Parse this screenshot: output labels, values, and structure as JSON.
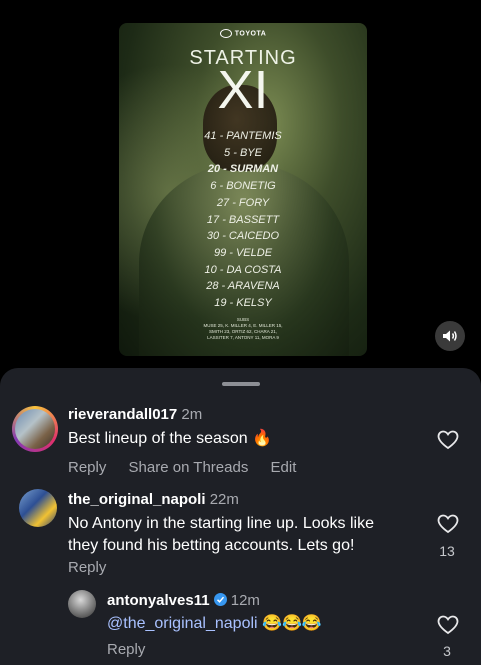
{
  "poster": {
    "brand": "TOYOTA",
    "title_small": "STARTING",
    "title_big": "XI",
    "lineup": [
      "41 - PANTEMIS",
      "5 - BYE",
      "20 - SURMAN",
      "6 - BONETIG",
      "27 - FORY",
      "17 - BASSETT",
      "30 - CAICEDO",
      "99 - VELDE",
      "10 - DA COSTA",
      "28 - ARAVENA",
      "19 - KELSY"
    ],
    "subs_label": "SUBS",
    "subs_line1": "MUSE 25, K. MILLER 4, E. MILLER 15,",
    "subs_line2": "SMITH 23, ORTIZ 62, CHARA 21,",
    "subs_line3": "LASSITER 7, ANTONY 11, MORA 9"
  },
  "sound_icon": "speaker-icon",
  "comments": [
    {
      "username": "rieverandall017",
      "time": "2m",
      "text": "Best lineup of the season 🔥",
      "reply": "Reply",
      "share": "Share on Threads",
      "edit": "Edit"
    },
    {
      "username": "the_original_napoli",
      "time": "22m",
      "text_line1": "No Antony in the starting line up. Looks like",
      "text_line2": "they found his betting accounts. Lets go!",
      "reply": "Reply",
      "likes": "13"
    },
    {
      "username": "antonyalves11",
      "time": "12m",
      "mention": "@the_original_napoli",
      "emojis": "😂😂😂",
      "reply": "Reply",
      "likes": "3"
    }
  ]
}
